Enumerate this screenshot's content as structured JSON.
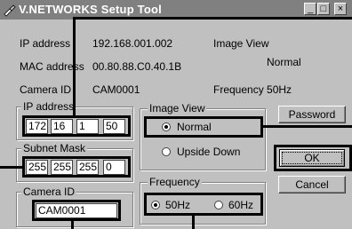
{
  "window": {
    "title": "V.NETWORKS Setup Tool",
    "controls": {
      "minimize": "_",
      "maximize": "□",
      "close": "×"
    }
  },
  "info": {
    "ip_label": "IP address",
    "ip_value": "192.168.001.002",
    "mac_label": "MAC address",
    "mac_value": "00.80.88.C0.40.1B",
    "camera_label": "Camera ID",
    "camera_value": "CAM0001",
    "image_view_label": "Image View",
    "image_view_value": "Normal",
    "frequency_value": "Frequency 50Hz"
  },
  "ip_group": {
    "legend": "IP address",
    "octets": [
      "172",
      "16",
      "1",
      "50"
    ]
  },
  "subnet_group": {
    "legend": "Subnet Mask",
    "octets": [
      "255",
      "255",
      "255",
      "0"
    ]
  },
  "camera_group": {
    "legend": "Camera ID",
    "value": "CAM0001"
  },
  "image_view_group": {
    "legend": "Image View",
    "options": [
      {
        "label": "Normal",
        "selected": true
      },
      {
        "label": "Upside Down",
        "selected": false
      }
    ]
  },
  "frequency_group": {
    "legend": "Frequency",
    "options": [
      {
        "label": "50Hz",
        "selected": true
      },
      {
        "label": "60Hz",
        "selected": false
      }
    ]
  },
  "buttons": {
    "password": "Password",
    "ok": "OK",
    "cancel": "Cancel"
  }
}
